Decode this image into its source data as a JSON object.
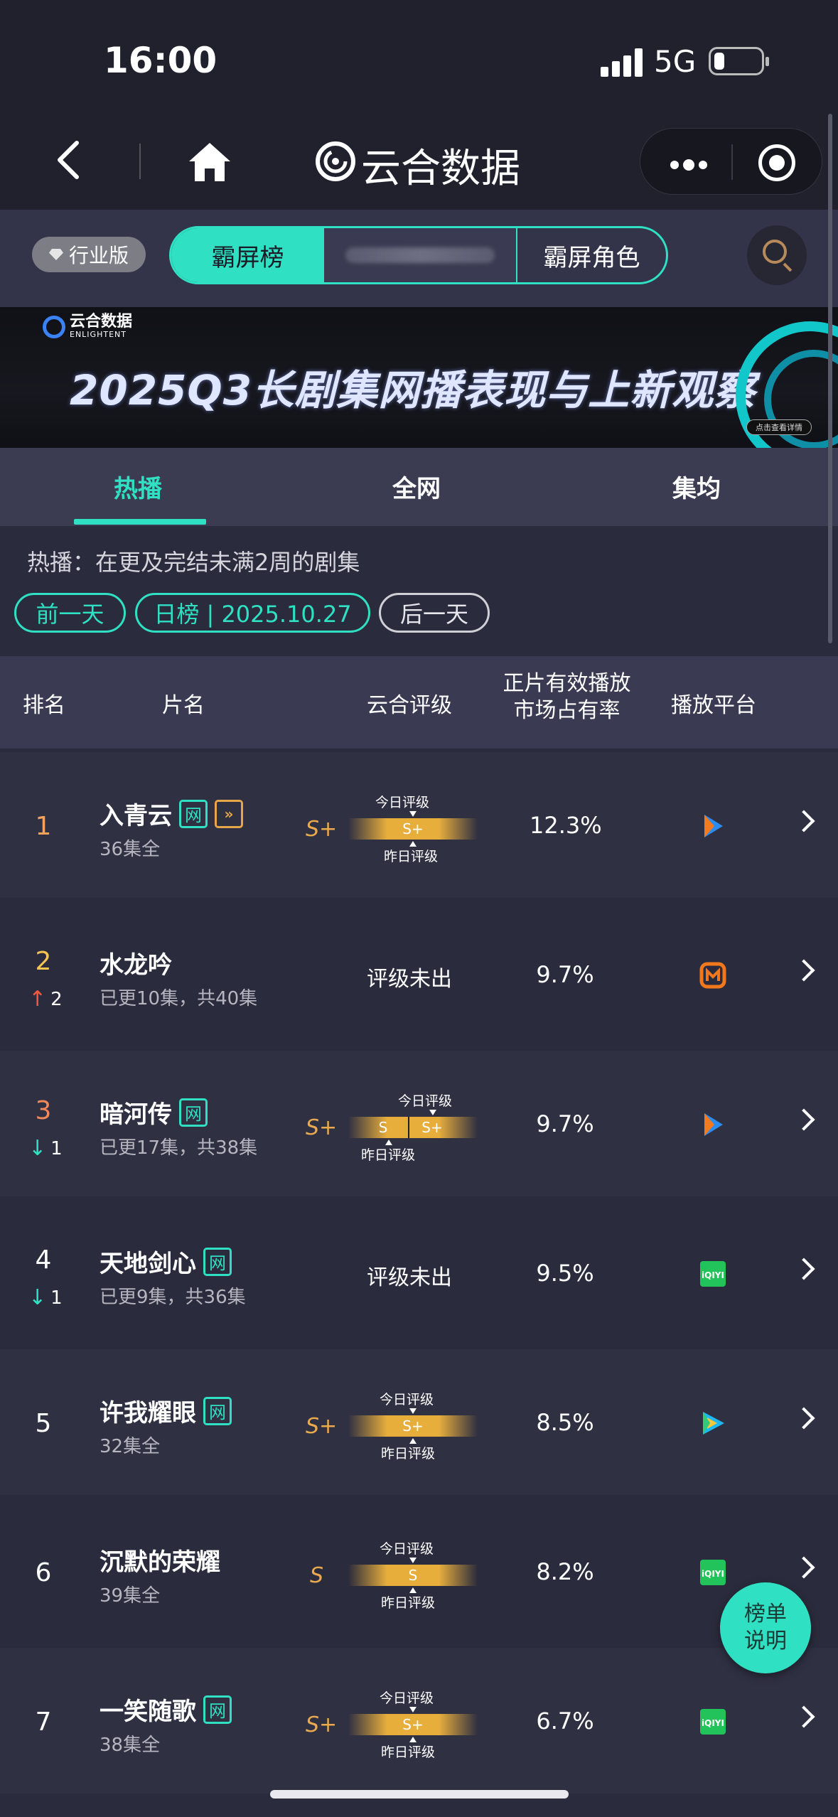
{
  "status": {
    "time": "16:00",
    "network": "5G"
  },
  "nav": {
    "title": "云合数据"
  },
  "filter": {
    "industry_badge": "行业版",
    "segments": [
      "霸屏榜",
      "",
      "霸屏角色"
    ]
  },
  "banner": {
    "logo_text": "云合数据",
    "logo_sub": "ENLIGHTENT",
    "title": "2025Q3长剧集网播表现与上新观察",
    "button": "点击查看详情"
  },
  "tabs": [
    "热播",
    "全网",
    "集均"
  ],
  "info": {
    "description": "热播：在更及完结未满2周的剧集",
    "prev_day": "前一天",
    "date_label": "日榜 | 2025.10.27",
    "next_day": "后一天"
  },
  "table": {
    "headers": {
      "rank": "排名",
      "name": "片名",
      "rating": "云合评级",
      "share_line1": "正片有效播放",
      "share_line2": "市场占有率",
      "platform": "播放平台"
    },
    "today_label": "今日评级",
    "yesterday_label": "昨日评级",
    "no_rating": "评级未出",
    "rows": [
      {
        "rank": "1",
        "change": "",
        "title": "入青云",
        "net_tag": "网",
        "ff_tag": "»",
        "sub": "36集全",
        "grade": "S+",
        "grade_today": "S+",
        "grade_yesterday": "S+",
        "share": "12.3%",
        "platform": "tencent-video-icon"
      },
      {
        "rank": "2",
        "change": "2",
        "change_dir": "up",
        "title": "水龙吟",
        "net_tag": "",
        "sub": "已更10集，共40集",
        "grade": "",
        "share": "9.7%",
        "platform": "mango-tv-icon"
      },
      {
        "rank": "3",
        "change": "1",
        "change_dir": "down",
        "title": "暗河传",
        "net_tag": "网",
        "sub": "已更17集，共38集",
        "grade": "S+",
        "grade_today": "S+",
        "grade_yesterday": "S",
        "share": "9.7%",
        "platform": "tencent-video-icon"
      },
      {
        "rank": "4",
        "change": "1",
        "change_dir": "down",
        "title": "天地剑心",
        "net_tag": "网",
        "sub": "已更9集，共36集",
        "grade": "",
        "share": "9.5%",
        "platform": "iqiyi-icon"
      },
      {
        "rank": "5",
        "change": "",
        "title": "许我耀眼",
        "net_tag": "网",
        "sub": "32集全",
        "grade": "S+",
        "grade_today": "S+",
        "grade_yesterday": "S+",
        "share": "8.5%",
        "platform": "tencent-video-play-icon"
      },
      {
        "rank": "6",
        "change": "",
        "title": "沉默的荣耀",
        "net_tag": "",
        "sub": "39集全",
        "grade": "S",
        "grade_today": "S",
        "grade_yesterday": "S",
        "share": "8.2%",
        "platform": "iqiyi-icon"
      },
      {
        "rank": "7",
        "change": "",
        "title": "一笑随歌",
        "net_tag": "网",
        "sub": "38集全",
        "grade": "S+",
        "grade_today": "S+",
        "grade_yesterday": "S+",
        "share": "6.7%",
        "platform": "iqiyi-icon"
      }
    ]
  },
  "fab": {
    "line1": "榜单",
    "line2": "说明"
  },
  "colors": {
    "accent": "#2fe0c2",
    "gold": "#e8ae3c",
    "up": "#f05a3c"
  }
}
